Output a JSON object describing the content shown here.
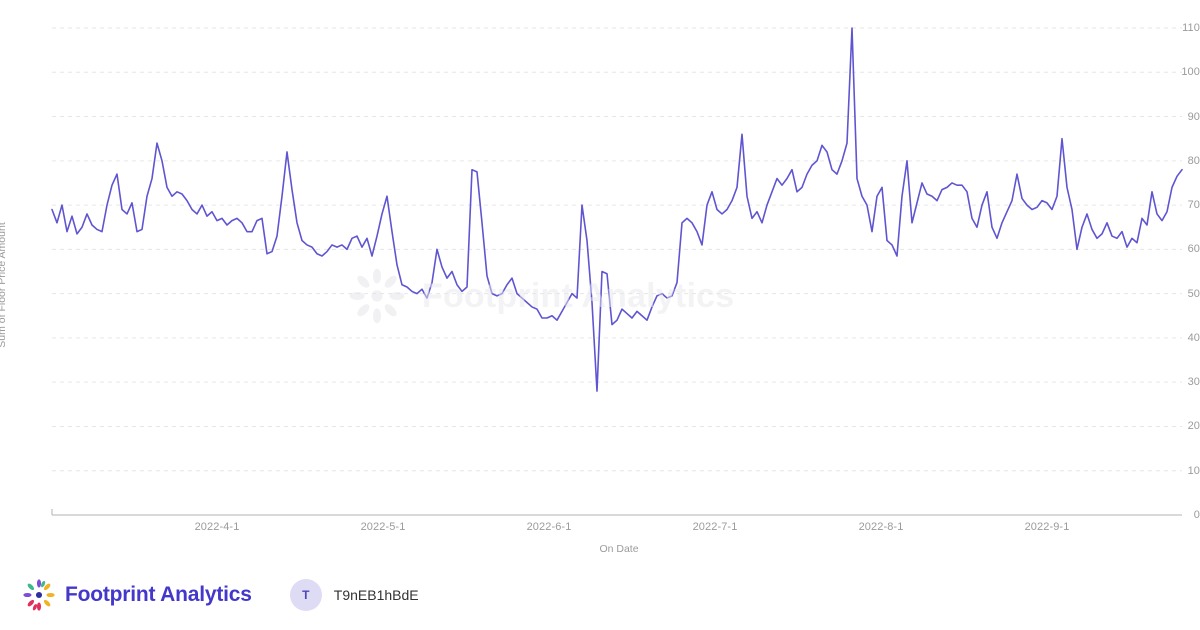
{
  "chart_data": {
    "type": "line",
    "title": "",
    "xlabel": "On Date",
    "ylabel": "Sum of Floor Price Amount",
    "ylim": [
      0,
      110
    ],
    "yticks": [
      0,
      10,
      20,
      30,
      40,
      50,
      60,
      70,
      80,
      90,
      100,
      110
    ],
    "xticks": [
      "2022-4-1",
      "2022-5-1",
      "2022-6-1",
      "2022-7-1",
      "2022-8-1",
      "2022-9-1"
    ],
    "grid": true,
    "legend": "none",
    "line_color": "#5f55d1",
    "x_start": "2022-3-14",
    "x_end": "2022-9-23",
    "series": [
      {
        "name": "Sum of Floor Price Amount",
        "values": [
          69,
          66,
          70,
          64,
          67.5,
          63.5,
          65,
          68,
          65.5,
          64.5,
          64,
          70,
          74.5,
          77,
          69,
          68,
          70.5,
          64,
          64.5,
          72,
          76,
          84,
          80,
          74,
          72,
          73,
          72.5,
          71,
          69,
          68,
          70,
          67.5,
          68.5,
          66.5,
          67,
          65.5,
          66.5,
          67,
          66,
          64,
          64,
          66.5,
          67,
          59,
          59.5,
          63,
          72,
          82,
          73.5,
          66,
          62,
          61,
          60.5,
          59,
          58.5,
          59.5,
          61,
          60.5,
          61,
          60,
          62.5,
          63,
          60.5,
          62.5,
          58.5,
          63,
          68,
          72,
          64,
          56.5,
          52,
          51.5,
          50.5,
          50,
          51,
          49,
          52.5,
          60,
          56,
          53.5,
          55,
          52,
          50.5,
          51.5,
          78,
          77.5,
          66,
          54,
          50,
          49.5,
          50,
          52,
          53.5,
          50,
          49,
          48,
          47,
          46.5,
          44.5,
          44.5,
          45,
          44,
          46,
          48,
          50,
          49,
          70,
          62,
          48,
          28,
          55,
          54.5,
          43,
          44,
          46.5,
          45.5,
          44.5,
          46,
          45,
          44,
          47,
          49.5,
          50,
          49,
          49.5,
          52.5,
          66,
          67,
          66,
          64,
          61,
          70,
          73,
          69,
          68,
          69,
          71,
          74,
          86,
          72,
          67,
          68.5,
          66,
          70,
          73,
          76,
          74.5,
          76,
          78,
          73,
          74,
          77,
          79,
          80,
          83.5,
          82,
          78,
          77,
          80,
          84,
          110,
          76,
          72,
          70,
          64,
          72,
          74,
          62,
          61,
          58.5,
          72,
          80,
          66,
          70.5,
          75,
          72.5,
          72,
          71,
          73.5,
          74,
          75,
          74.5,
          74.5,
          73,
          67,
          65,
          70,
          73,
          65,
          62.5,
          66,
          68.5,
          71,
          77,
          71.5,
          70,
          69,
          69.5,
          71,
          70.5,
          69,
          72,
          85,
          74,
          69,
          60,
          65,
          68,
          64.5,
          62.5,
          63.5,
          66,
          63,
          62.5,
          64,
          60.5,
          62.5,
          61.5,
          67,
          65.5,
          73,
          68,
          66.5,
          68.5,
          74,
          76.5,
          78
        ]
      }
    ]
  },
  "watermark": {
    "text": "Footprint Analytics"
  },
  "footer": {
    "brand_name": "Footprint Analytics",
    "avatar_initial": "T",
    "username": "T9nEB1hBdE"
  },
  "colors": {
    "line": "#5f55d1",
    "grid": "#e6e6e6",
    "axis": "#b3b3b3",
    "tick_text": "#9b9b9b",
    "brand": "#4338ca",
    "avatar_bg": "#dedcf5",
    "avatar_text": "#4f46b8"
  }
}
